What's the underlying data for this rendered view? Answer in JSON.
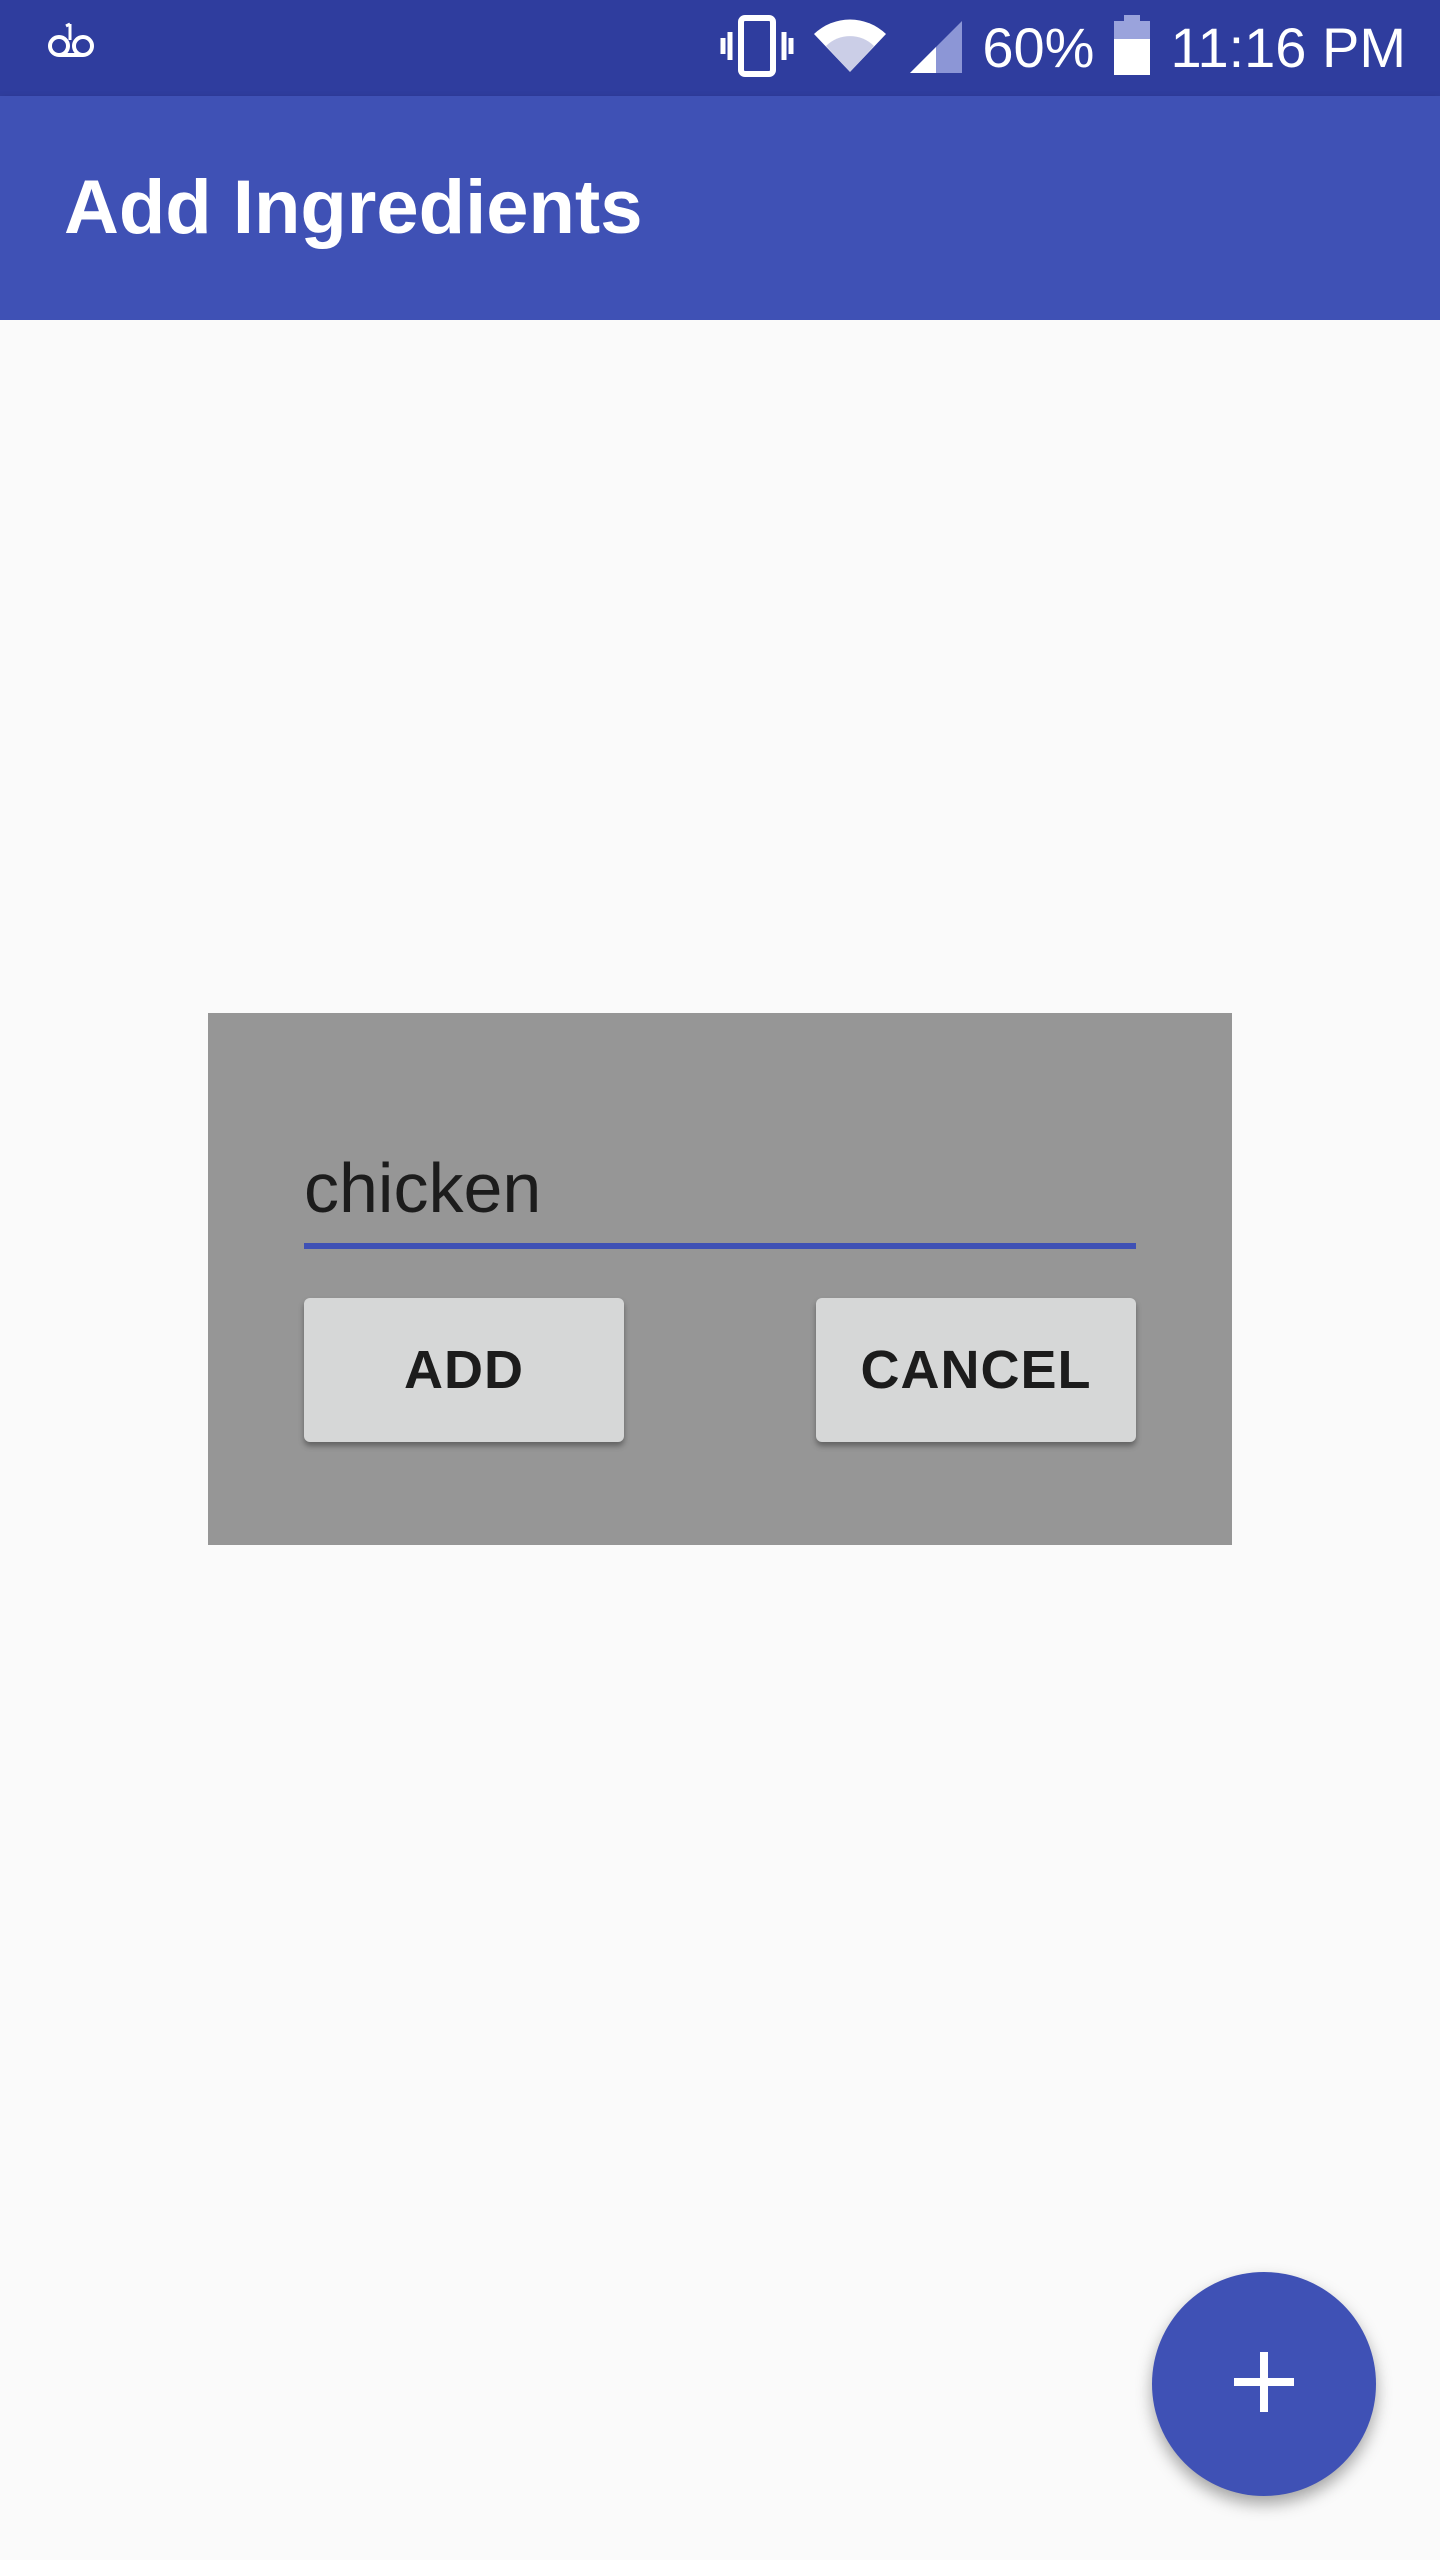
{
  "status_bar": {
    "battery_percent": "60%",
    "time": "11:16 PM",
    "icons": [
      "voicemail-icon",
      "vibrate-icon",
      "wifi-icon",
      "signal-icon",
      "battery-icon"
    ],
    "color": "#2f3d9e"
  },
  "app_bar": {
    "title": "Add Ingredients",
    "color": "#3f51b5"
  },
  "dialog": {
    "input_value": "chicken",
    "add_label": "ADD",
    "cancel_label": "CANCEL",
    "background": "#969696",
    "accent": "#3f51b5"
  },
  "fab": {
    "icon": "plus-icon",
    "color": "#3f51b5"
  }
}
